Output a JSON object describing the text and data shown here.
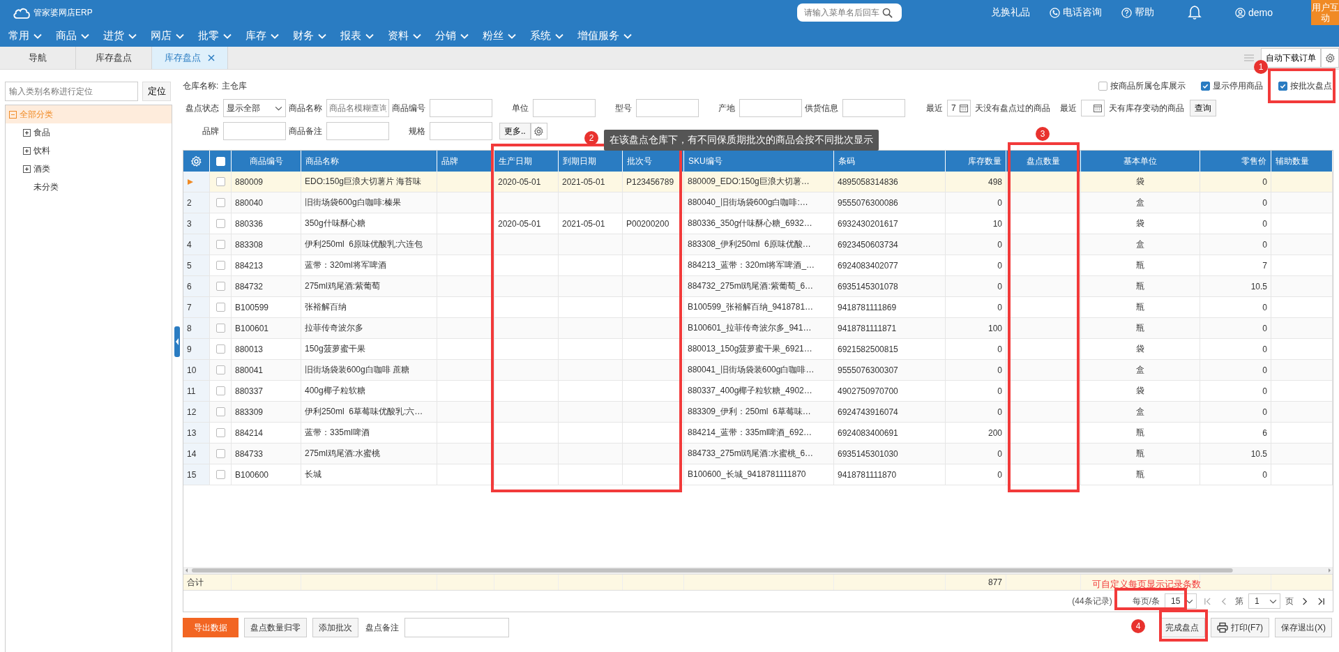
{
  "app": {
    "title": "管家婆网店ERP"
  },
  "menu_search": {
    "placeholder": "请输入菜单名后回车"
  },
  "header_links": [
    {
      "kind": "text",
      "label": "兑换礼品"
    },
    {
      "kind": "phone",
      "label": "电话咨询"
    },
    {
      "kind": "help",
      "label": "帮助"
    },
    {
      "kind": "bell"
    },
    {
      "kind": "user",
      "label": "demo"
    }
  ],
  "feedback_badge": "用户互动",
  "menu": [
    "常用",
    "商品",
    "进货",
    "网店",
    "批零",
    "库存",
    "财务",
    "报表",
    "资料",
    "分销",
    "粉丝",
    "系统",
    "增值服务"
  ],
  "tabs": [
    {
      "label": "导航",
      "selected": false,
      "closable": false
    },
    {
      "label": "库存盘点",
      "selected": false,
      "closable": false
    },
    {
      "label": "库存盘点",
      "selected": true,
      "closable": true
    }
  ],
  "tab_tools": {
    "button": "自动下载订单"
  },
  "sidebar": {
    "search_placeholder": "输入类别名称进行定位",
    "locate_button": "定位",
    "tree": [
      {
        "label": "全部分类",
        "selected": true,
        "expanded": true,
        "children": [
          {
            "label": "食品",
            "selected": false,
            "expanded": false
          },
          {
            "label": "饮料",
            "selected": false,
            "expanded": false
          },
          {
            "label": "酒类",
            "selected": false,
            "expanded": false
          },
          {
            "label": "未分类",
            "selected": false
          }
        ]
      }
    ]
  },
  "warehouse": {
    "label": "仓库名称:",
    "value": "主仓库"
  },
  "display_options": [
    {
      "label": "按商品所属仓库展示",
      "checked": false
    },
    {
      "label": "显示停用商品",
      "checked": true
    },
    {
      "label": "按批次盘点",
      "checked": true
    }
  ],
  "filters": [
    {
      "kind": "select",
      "label": "盘点状态",
      "value": "显示全部"
    },
    {
      "kind": "input",
      "label": "商品名称",
      "placeholder": "商品名模糊查询"
    },
    {
      "kind": "input",
      "label": "商品编号"
    },
    {
      "kind": "input",
      "label": "单位"
    },
    {
      "kind": "input",
      "label": "型号"
    },
    {
      "kind": "input",
      "label": "产地"
    },
    {
      "kind": "input",
      "label": "供货信息"
    }
  ],
  "recent_filters": [
    {
      "label": "最近",
      "value": "7",
      "suffix": "天没有盘点过的商品"
    },
    {
      "label": "最近",
      "suffix": "天有库存变动的商品"
    }
  ],
  "query_button": "查询",
  "filters_row2": [
    {
      "kind": "input",
      "label": "品牌"
    },
    {
      "kind": "input",
      "label": "商品备注"
    },
    {
      "kind": "input",
      "label": "规格"
    }
  ],
  "more_button": "更多..",
  "table": {
    "header_checked": false,
    "columns": [
      "商品编号",
      "商品名称",
      "品牌",
      "生产日期",
      "到期日期",
      "批次号",
      "SKU编号",
      "条码",
      "库存数量",
      "盘点数量",
      "基本单位",
      "零售价",
      "辅助数量"
    ],
    "rows": [
      {
        "selected": true,
        "checked": false,
        "code": "880009",
        "name": "EDO:150g巨浪大切薯片 海苔味",
        "production_date": "2020-05-01",
        "expiry_date": "2021-05-01",
        "batch_no": "P123456789",
        "sku": "880009_EDO:150g巨浪大切薯…",
        "barcode": "4895058314836",
        "stock": "498",
        "unit": "袋",
        "retail_price": "0"
      },
      {
        "row_number": "2",
        "selected": false,
        "checked": false,
        "code": "880040",
        "name": "旧街场袋600g白咖啡:榛果",
        "sku": "880040_旧街场袋600g白咖啡:…",
        "barcode": "9555076300086",
        "stock": "0",
        "unit": "盒",
        "retail_price": "0"
      },
      {
        "row_number": "3",
        "selected": false,
        "checked": false,
        "code": "880336",
        "name": "350g什味酥心糖",
        "production_date": "2020-05-01",
        "expiry_date": "2021-05-01",
        "batch_no": "P00200200",
        "sku": "880336_350g什味酥心糖_6932…",
        "barcode": "6932430201617",
        "stock": "10",
        "unit": "袋",
        "retail_price": "0"
      },
      {
        "row_number": "4",
        "selected": false,
        "checked": false,
        "code": "883308",
        "name": "伊利250ml  6原味优酸乳:六连包",
        "sku": "883308_伊利250ml  6原味优酸…",
        "barcode": "6923450603734",
        "stock": "0",
        "unit": "盒",
        "retail_price": "0"
      },
      {
        "row_number": "5",
        "selected": false,
        "checked": false,
        "code": "884213",
        "name": "蓝带：320ml将军啤酒",
        "sku": "884213_蓝带：320ml将军啤酒_…",
        "barcode": "6924083402077",
        "stock": "0",
        "unit": "瓶",
        "retail_price": "7"
      },
      {
        "row_number": "6",
        "selected": false,
        "checked": false,
        "code": "884732",
        "name": "275ml鸡尾酒:紫葡萄",
        "sku": "884732_275ml鸡尾酒:紫葡萄_6…",
        "barcode": "6935145301078",
        "stock": "0",
        "unit": "瓶",
        "retail_price": "10.5"
      },
      {
        "row_number": "7",
        "selected": false,
        "checked": false,
        "code": "B100599",
        "name": "张裕解百纳",
        "sku": "B100599_张裕解百纳_9418781…",
        "barcode": "9418781111869",
        "stock": "0",
        "unit": "瓶",
        "retail_price": "0"
      },
      {
        "row_number": "8",
        "selected": false,
        "checked": false,
        "code": "B100601",
        "name": "拉菲传奇波尔多",
        "sku": "B100601_拉菲传奇波尔多_941…",
        "barcode": "9418781111871",
        "stock": "100",
        "unit": "瓶",
        "retail_price": "0"
      },
      {
        "row_number": "9",
        "selected": false,
        "checked": false,
        "code": "880013",
        "name": "150g菠萝蜜干果",
        "sku": "880013_150g菠萝蜜干果_6921…",
        "barcode": "6921582500815",
        "stock": "0",
        "unit": "袋",
        "retail_price": "0"
      },
      {
        "row_number": "10",
        "selected": false,
        "checked": false,
        "code": "880041",
        "name": "旧街场袋装600g白咖啡 蔗糖",
        "sku": "880041_旧街场袋装600g白咖啡…",
        "barcode": "9555076300307",
        "stock": "0",
        "unit": "盒",
        "retail_price": "0"
      },
      {
        "row_number": "11",
        "selected": false,
        "checked": false,
        "code": "880337",
        "name": "400g椰子粒软糖",
        "sku": "880337_400g椰子粒软糖_4902…",
        "barcode": "4902750970700",
        "stock": "0",
        "unit": "袋",
        "retail_price": "0"
      },
      {
        "row_number": "12",
        "selected": false,
        "checked": false,
        "code": "883309",
        "name": "伊利250ml  6草莓味优酸乳:六…",
        "sku": "883309_伊利：250ml  6草莓味…",
        "barcode": "6924743916074",
        "stock": "0",
        "unit": "盒",
        "retail_price": "0"
      },
      {
        "row_number": "13",
        "selected": false,
        "checked": false,
        "code": "884214",
        "name": "蓝带：335ml啤酒",
        "sku": "884214_蓝带：335ml啤酒_692…",
        "barcode": "6924083400691",
        "stock": "200",
        "unit": "瓶",
        "retail_price": "6"
      },
      {
        "row_number": "14",
        "selected": false,
        "checked": false,
        "code": "884733",
        "name": "275ml鸡尾酒:水蜜桃",
        "sku": "884733_275ml鸡尾酒:水蜜桃_6…",
        "barcode": "6935145301030",
        "stock": "0",
        "unit": "瓶",
        "retail_price": "10.5"
      },
      {
        "row_number": "15",
        "selected": false,
        "checked": false,
        "code": "B100600",
        "name": "长城",
        "sku": "B100600_长城_9418781111870",
        "barcode": "9418781111870",
        "stock": "0",
        "unit": "瓶",
        "retail_price": "0"
      }
    ],
    "summary": {
      "label": "合计",
      "stock_total": "877"
    }
  },
  "pager": {
    "total": "(44条记录)",
    "per_page_label": "每页/条",
    "per_page": "15",
    "page_label": "第",
    "page": "1",
    "page_suffix": "页"
  },
  "bottom_actions": {
    "left": [
      {
        "kind": "primary",
        "label": "导出数据"
      },
      {
        "kind": "default",
        "label": "盘点数量归零"
      },
      {
        "kind": "default",
        "label": "添加批次"
      }
    ],
    "note_label": "盘点备注",
    "right": [
      {
        "kind": "default",
        "label": "完成盘点"
      },
      {
        "kind": "print",
        "label": "打印(F7)"
      },
      {
        "kind": "default",
        "label": "保存退出(X)"
      }
    ]
  },
  "annotations": [
    {
      "number": "1"
    },
    {
      "number": "2",
      "text": "在该盘点仓库下，有不同保质期批次的商品会按不同批次显示"
    },
    {
      "number": "3"
    },
    {
      "number": "4"
    }
  ],
  "page_size_hint": "可自定义每页显示记录条数"
}
